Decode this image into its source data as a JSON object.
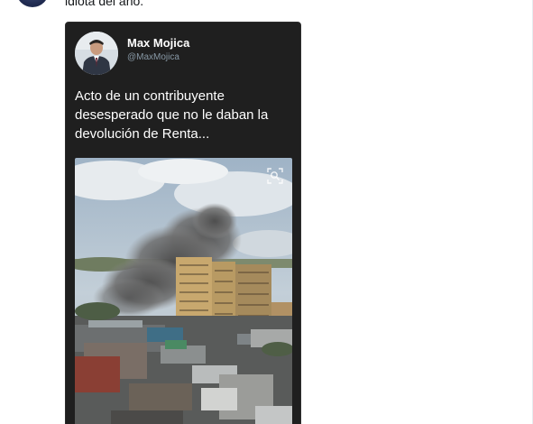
{
  "tweet": {
    "text": "idiota del año."
  },
  "quoted_tweet": {
    "author_name": "Max Mojica",
    "author_handle": "@MaxMojica",
    "text": "Acto de un contribuyente desesperado que no le daban la devolución de Renta..."
  },
  "icons": {
    "avatar": "avatar-icon",
    "zoom": "zoom-image-icon"
  },
  "colors": {
    "card_background": "#1f1f1f",
    "handle": "#8899a6",
    "text": "#14171a"
  }
}
